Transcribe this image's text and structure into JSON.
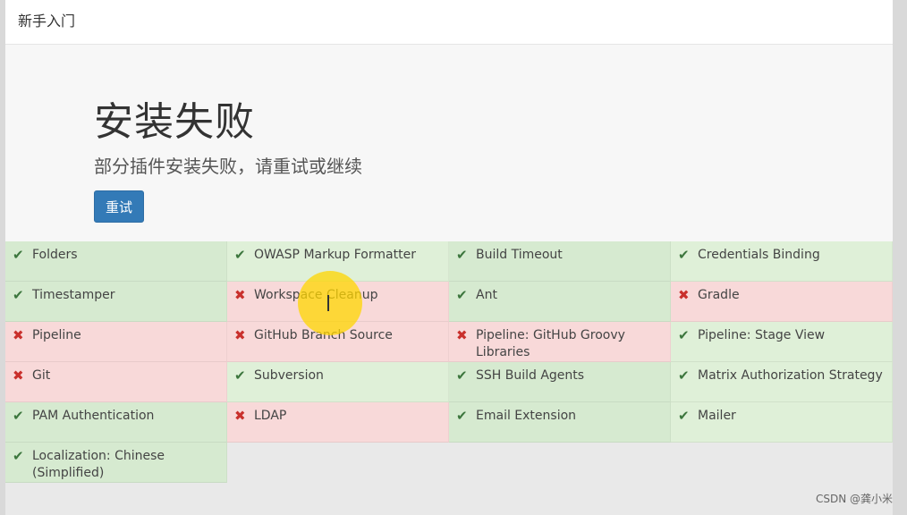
{
  "header": {
    "title": "新手入门"
  },
  "hero": {
    "title": "安装失败",
    "subtitle": "部分插件安装失败，请重试或继续",
    "retry_label": "重试"
  },
  "icons": {
    "success": "✔",
    "fail": "✖"
  },
  "plugins": [
    {
      "name": "Folders",
      "status": "success"
    },
    {
      "name": "OWASP Markup Formatter",
      "status": "success"
    },
    {
      "name": "Build Timeout",
      "status": "success"
    },
    {
      "name": "Credentials Binding",
      "status": "success"
    },
    {
      "name": "Timestamper",
      "status": "success"
    },
    {
      "name": "Workspace Cleanup",
      "status": "fail"
    },
    {
      "name": "Ant",
      "status": "success"
    },
    {
      "name": "Gradle",
      "status": "fail"
    },
    {
      "name": "Pipeline",
      "status": "fail"
    },
    {
      "name": "GitHub Branch Source",
      "status": "fail"
    },
    {
      "name": "Pipeline: GitHub Groovy Libraries",
      "status": "fail"
    },
    {
      "name": "Pipeline: Stage View",
      "status": "success"
    },
    {
      "name": "Git",
      "status": "fail"
    },
    {
      "name": "Subversion",
      "status": "success"
    },
    {
      "name": "SSH Build Agents",
      "status": "success"
    },
    {
      "name": "Matrix Authorization Strategy",
      "status": "success"
    },
    {
      "name": "PAM Authentication",
      "status": "success"
    },
    {
      "name": "LDAP",
      "status": "fail"
    },
    {
      "name": "Email Extension",
      "status": "success"
    },
    {
      "name": "Mailer",
      "status": "success"
    },
    {
      "name": "Localization: Chinese (Simplified)",
      "status": "success"
    }
  ],
  "watermark": "CSDN @龚小米"
}
